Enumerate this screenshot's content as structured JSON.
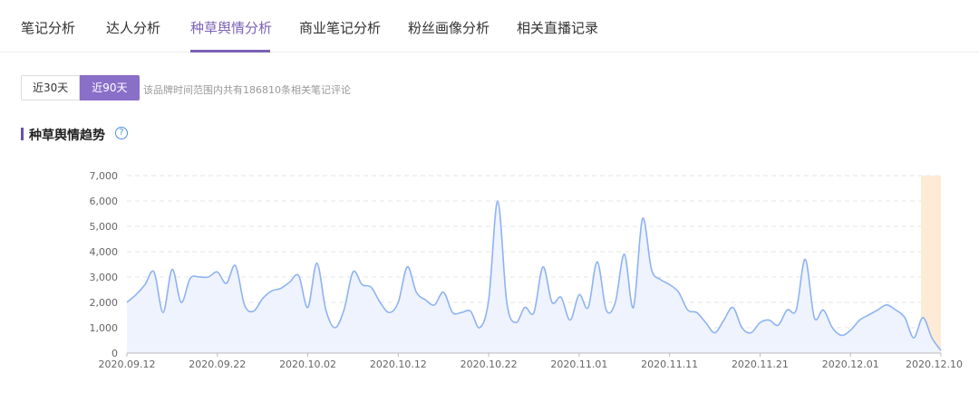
{
  "tabs": [
    {
      "label": "笔记分析"
    },
    {
      "label": "达人分析"
    },
    {
      "label": "种草舆情分析"
    },
    {
      "label": "商业笔记分析"
    },
    {
      "label": "粉丝画像分析"
    },
    {
      "label": "相关直播记录"
    }
  ],
  "active_tab": 2,
  "range": {
    "btn30": "近30天",
    "btn90": "近90天",
    "active": "近90天",
    "note": "该品牌时间范围内共有186810条相关笔记评论"
  },
  "section": {
    "title": "种草舆情趋势",
    "help_icon": "question-circle-icon"
  },
  "colors": {
    "accent": "#7b61b6",
    "line": "#8fb3f0",
    "area": "#eef3fd",
    "highlight": "#fdebd6"
  },
  "chart_data": {
    "type": "area",
    "title": "",
    "xlabel": "",
    "ylabel": "",
    "ylim": [
      0,
      7000
    ],
    "yticks": [
      0,
      1000,
      2000,
      3000,
      4000,
      5000,
      6000,
      7000
    ],
    "ytick_labels": [
      "0",
      "1,000",
      "2,000",
      "3,000",
      "4,000",
      "5,000",
      "6,000",
      "7,000"
    ],
    "x_start": "2020.09.12",
    "x_end": "2020.12.10",
    "xtick_labels": [
      "2020.09.12",
      "2020.09.22",
      "2020.10.02",
      "2020.10.12",
      "2020.10.22",
      "2020.11.01",
      "2020.11.11",
      "2020.11.21",
      "2020.12.01",
      "2020.12.10"
    ],
    "grid": true,
    "highlight_range": [
      "2020.12.09",
      "2020.12.10"
    ],
    "series": [
      {
        "values": [
          2000,
          2300,
          2700,
          3200,
          1600,
          3300,
          2000,
          2950,
          3000,
          3000,
          3200,
          2750,
          3450,
          1900,
          1650,
          2150,
          2450,
          2550,
          2800,
          3050,
          1800,
          3550,
          1700,
          1000,
          1700,
          3200,
          2700,
          2600,
          2000,
          1600,
          2000,
          3400,
          2400,
          2100,
          1900,
          2400,
          1600,
          1600,
          1650,
          1000,
          2100,
          6000,
          2000,
          1200,
          1800,
          1600,
          3400,
          2000,
          2200,
          1300,
          2300,
          1800,
          3600,
          1700,
          2000,
          3900,
          1800,
          5300,
          3300,
          2900,
          2700,
          2400,
          1700,
          1600,
          1200,
          800,
          1300,
          1800,
          1000,
          800,
          1200,
          1300,
          1100,
          1700,
          1700,
          3700,
          1400,
          1700,
          1000,
          700,
          900,
          1300,
          1500,
          1700,
          1900,
          1700,
          1400,
          600,
          1400,
          600,
          100
        ]
      }
    ]
  }
}
